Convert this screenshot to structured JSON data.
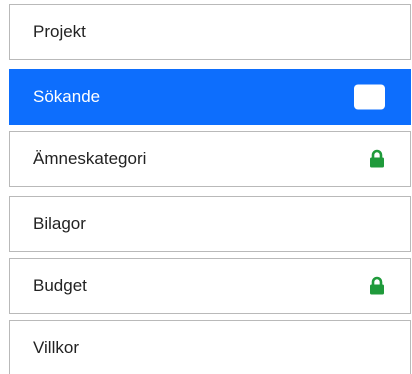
{
  "accent_color": "#0d6efd",
  "lock_color": "#1f9a3b",
  "nav": {
    "items": [
      {
        "label": "Projekt",
        "active": false,
        "icon": null
      },
      {
        "label": "Sökande",
        "active": true,
        "icon": "checkbox-icon"
      },
      {
        "label": "Ämneskategori",
        "active": false,
        "icon": "lock-icon"
      },
      {
        "label": "Bilagor",
        "active": false,
        "icon": null
      },
      {
        "label": "Budget",
        "active": false,
        "icon": "lock-icon"
      },
      {
        "label": "Villkor",
        "active": false,
        "icon": null
      }
    ]
  }
}
